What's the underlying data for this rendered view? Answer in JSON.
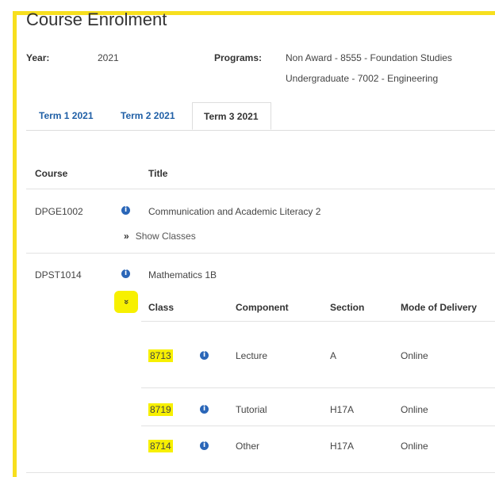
{
  "page": {
    "title": "Course Enrolment"
  },
  "info": {
    "year_label": "Year:",
    "year_value": "2021",
    "programs_label": "Programs:",
    "programs": [
      "Non Award - 8555 - Foundation Studies",
      "Undergraduate - 7002 - Engineering"
    ]
  },
  "tabs": [
    {
      "label": "Term 1 2021",
      "active": false
    },
    {
      "label": "Term 2 2021",
      "active": false
    },
    {
      "label": "Term 3 2021",
      "active": true
    }
  ],
  "course_table": {
    "headers": {
      "course": "Course",
      "title": "Title"
    },
    "rows": [
      {
        "code": "DPGE1002",
        "title": "Communication and Academic Literacy 2",
        "toggle": "Show Classes",
        "toggle_glyph": "»"
      },
      {
        "code": "DPST1014",
        "title": "Mathematics 1B",
        "toggle_glyph": "»"
      }
    ]
  },
  "class_table": {
    "headers": {
      "class": "Class",
      "component": "Component",
      "section": "Section",
      "mode": "Mode of Delivery"
    },
    "rows": [
      {
        "class": "8713",
        "component": "Lecture",
        "section": "A",
        "mode": "Online"
      },
      {
        "class": "8719",
        "component": "Tutorial",
        "section": "H17A",
        "mode": "Online"
      },
      {
        "class": "8714",
        "component": "Other",
        "section": "H17A",
        "mode": "Online"
      }
    ]
  },
  "icons": {
    "info": "info-circle-icon",
    "expand": "double-chevron-right-icon",
    "collapse": "double-chevron-down-icon"
  },
  "colors": {
    "highlight": "#f7f000",
    "frame": "#f7df1e",
    "link": "#1f5fa6",
    "info": "#2a66b8"
  }
}
